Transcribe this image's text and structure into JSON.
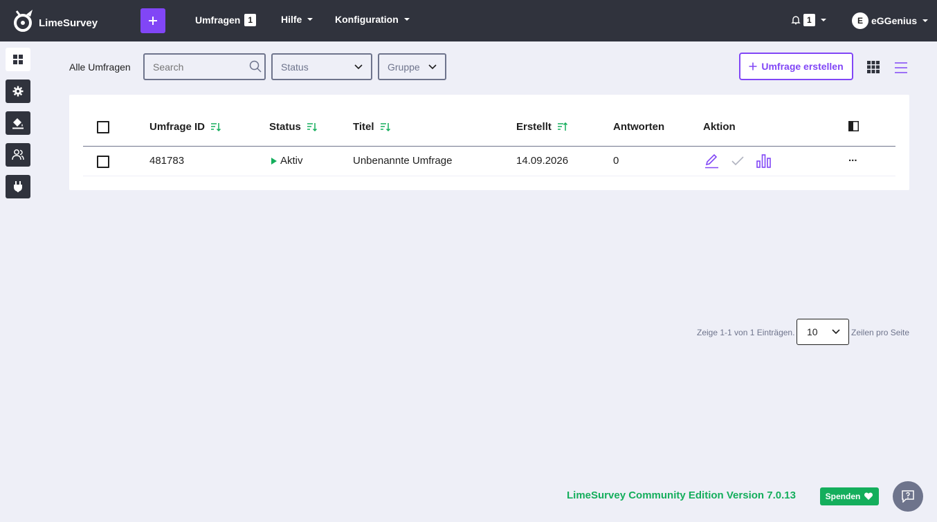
{
  "brand": {
    "name": "LimeSurvey"
  },
  "nav": {
    "items": [
      {
        "label": "Umfragen",
        "badge": "1"
      },
      {
        "label": "Hilfe"
      },
      {
        "label": "Konfiguration"
      }
    ],
    "notifications_count": "1",
    "user": {
      "initial": "E",
      "name": "eGGenius"
    }
  },
  "sidebar": {
    "items": [
      {
        "name": "dashboard",
        "icon": "grid-icon"
      },
      {
        "name": "settings",
        "icon": "gear-icon"
      },
      {
        "name": "themes",
        "icon": "paint-bucket-icon"
      },
      {
        "name": "users",
        "icon": "users-icon"
      },
      {
        "name": "plugins",
        "icon": "plug-icon"
      }
    ]
  },
  "toolbar": {
    "breadcrumb": "Alle Umfragen",
    "search_placeholder": "Search",
    "status_select": "Status",
    "group_select": "Gruppe",
    "create_label": "Umfrage erstellen"
  },
  "table": {
    "columns": [
      "Umfrage ID",
      "Status",
      "Titel",
      "Erstellt",
      "Antworten",
      "Aktion"
    ],
    "rows": [
      {
        "id": "481783",
        "status": "Aktiv",
        "title": "Unbenannte Umfrage",
        "created": "14.09.2026",
        "responses": "0",
        "more": "..."
      }
    ]
  },
  "pagination": {
    "summary": "Zeige 1-1 von 1 Einträgen.",
    "page_size": "10",
    "suffix": "Zeilen pro Seite"
  },
  "footer": {
    "version": "LimeSurvey Community Edition Version 7.0.13",
    "donate_label": "Spenden"
  },
  "colors": {
    "topbar": "#30333d",
    "accent": "#8146f6",
    "success": "#14ae5c",
    "background": "#eeeff7"
  }
}
